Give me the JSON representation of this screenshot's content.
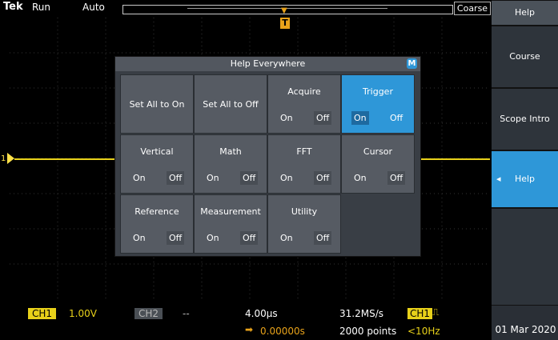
{
  "header": {
    "brand": "Tek",
    "run": "Run",
    "trigger_mode": "Auto",
    "knob_mode": "Coarse"
  },
  "side_menu": {
    "title": "Help",
    "items": [
      "Course",
      "Scope Intro",
      "Help Everywhere"
    ],
    "active_index": 2
  },
  "dialog": {
    "title": "Help Everywhere",
    "badge": "M",
    "set_all_on": "Set All to On",
    "set_all_off": "Set All to Off",
    "cells": [
      {
        "label": "Acquire",
        "on": "On",
        "off": "Off",
        "state": "off"
      },
      {
        "label": "Trigger",
        "on": "On",
        "off": "Off",
        "state": "on"
      },
      {
        "label": "Vertical",
        "on": "On",
        "off": "Off",
        "state": "off"
      },
      {
        "label": "Math",
        "on": "On",
        "off": "Off",
        "state": "off"
      },
      {
        "label": "FFT",
        "on": "On",
        "off": "Off",
        "state": "off"
      },
      {
        "label": "Cursor",
        "on": "On",
        "off": "Off",
        "state": "off"
      },
      {
        "label": "Reference",
        "on": "On",
        "off": "Off",
        "state": "off"
      },
      {
        "label": "Measurement",
        "on": "On",
        "off": "Off",
        "state": "off"
      },
      {
        "label": "Utility",
        "on": "On",
        "off": "Off",
        "state": "off"
      }
    ]
  },
  "status": {
    "ch1_label": "CH1",
    "ch1_scale": "1.00V",
    "ch2_label": "CH2",
    "ch2_scale": "--",
    "timebase": "4.00µs",
    "delay": "0.00000s",
    "sample_rate": "31.2MS/s",
    "record_length": "2000 points",
    "trig_source": "CH1",
    "trig_symbol": "⎍",
    "trig_freq": "<10Hz",
    "date": "01 Mar 2020",
    "trigger_marker": "T",
    "ch_marker": "1"
  },
  "colors": {
    "ch1": "#e8d11a",
    "accent": "#2e97d8",
    "trigger": "#e8a21a"
  }
}
